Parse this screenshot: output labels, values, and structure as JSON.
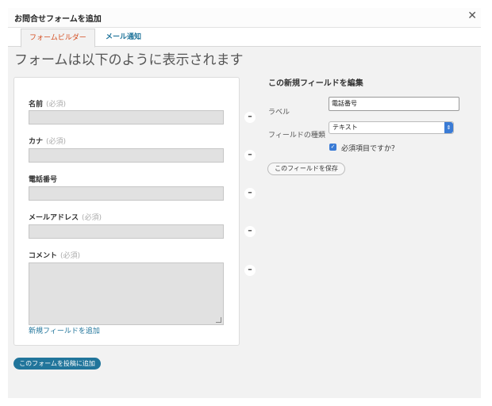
{
  "window": {
    "title": "お問合せフォームを追加",
    "close_label": "✕"
  },
  "tabs": [
    {
      "label": "フォームビルダー",
      "active": true
    },
    {
      "label": "メール通知",
      "active": false
    }
  ],
  "preview": {
    "heading": "フォームは以下のように表示されます",
    "fields": [
      {
        "label": "名前",
        "required_text": "(必須)",
        "type": "text"
      },
      {
        "label": "カナ",
        "required_text": "(必須)",
        "type": "text"
      },
      {
        "label": "電話番号",
        "required_text": "",
        "type": "text"
      },
      {
        "label": "メールアドレス",
        "required_text": "(必須)",
        "type": "text"
      },
      {
        "label": "コメント",
        "required_text": "(必須)",
        "type": "textarea"
      }
    ],
    "remove_label": "–",
    "add_field_label": "新規フィールドを追加",
    "submit_label": "このフォームを投稿に追加"
  },
  "editor": {
    "title": "この新規フィールドを編集",
    "label_caption": "ラベル",
    "label_value": "電話番号",
    "type_caption": "フィールドの種類",
    "type_value": "テキスト",
    "select_arrow": "⇕",
    "required_mark": "✓",
    "required_label": "必須項目ですか？",
    "required_checked": true,
    "save_label": "このフィールドを保存"
  }
}
